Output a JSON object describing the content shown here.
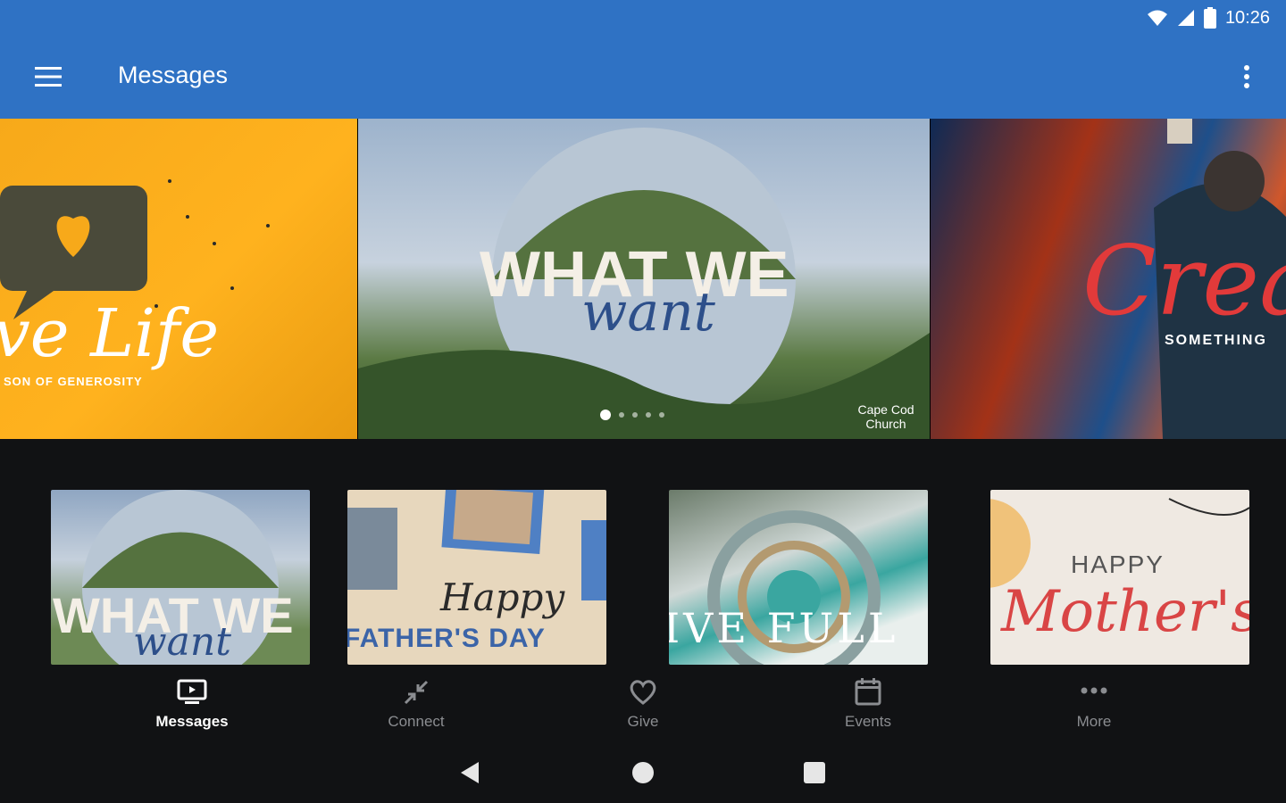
{
  "status": {
    "time": "10:26"
  },
  "appbar": {
    "title": "Messages"
  },
  "hero": {
    "slides": [
      {
        "title": "ve Life",
        "subtitle": "SON OF GENEROSITY"
      },
      {
        "title": "WHAT WE",
        "script": "want",
        "brand": "Cape Cod Church"
      },
      {
        "title": "Creat",
        "subtitle": "SOMETHING"
      }
    ],
    "dots": 5,
    "active_dot": 0
  },
  "thumbnails": [
    {
      "title": "WHAT WE",
      "script": "want"
    },
    {
      "title": "FATHER'S DAY",
      "script": "Happy"
    },
    {
      "title": "IVE FULL"
    },
    {
      "title": "HAPPY",
      "script": "Mother's"
    }
  ],
  "nav": {
    "items": [
      {
        "label": "Messages",
        "icon": "tv-play-icon"
      },
      {
        "label": "Connect",
        "icon": "connect-arrows-icon"
      },
      {
        "label": "Give",
        "icon": "heart-icon"
      },
      {
        "label": "Events",
        "icon": "calendar-icon"
      },
      {
        "label": "More",
        "icon": "more-dots-icon"
      }
    ],
    "active": 0
  },
  "colors": {
    "appbar": "#2f72c4",
    "background": "#111214",
    "nav_inactive": "#8b8d91"
  }
}
